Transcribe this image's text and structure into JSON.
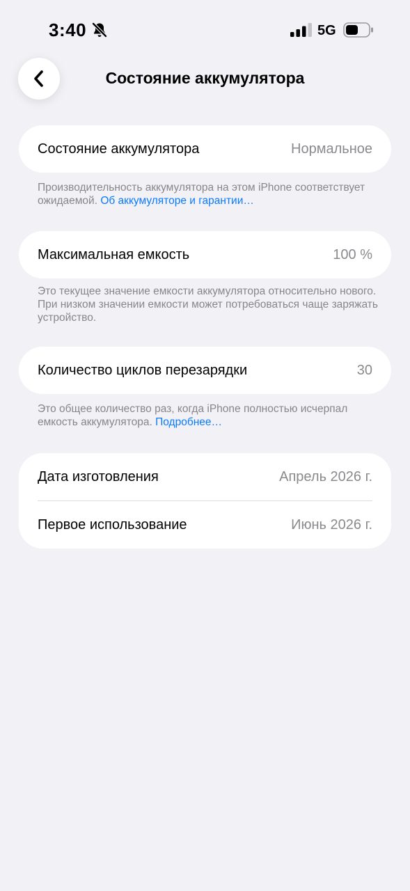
{
  "status_bar": {
    "time": "3:40",
    "network": "5G"
  },
  "nav": {
    "title": "Состояние аккумулятора"
  },
  "battery_health": {
    "label": "Состояние аккумулятора",
    "value": "Нормальное",
    "footnote_text": "Производительность аккумулятора на этом iPhone соответствует ожидаемой.",
    "footnote_link": "Об аккумуляторе и гарантии…"
  },
  "max_capacity": {
    "label": "Максимальная емкость",
    "value": "100 %",
    "footnote_text": "Это текущее значение емкости аккумулятора относительно нового. При низком значении емкости может потребоваться чаще заряжать устройство."
  },
  "cycle_count": {
    "label": "Количество циклов перезарядки",
    "value": "30",
    "footnote_text": "Это общее количество раз, когда iPhone полностью исчерпал емкость аккумулятора.",
    "footnote_link": "Подробнее…"
  },
  "dates": {
    "manufacture_label": "Дата изготовления",
    "manufacture_value": "Апрель 2026 г.",
    "first_use_label": "Первое использование",
    "first_use_value": "Июнь 2026 г."
  },
  "icons": {
    "bell": "bell-slash-icon",
    "signal": "cellular-signal-icon",
    "battery": "battery-icon",
    "back": "chevron-left-icon"
  },
  "colors": {
    "background": "#f1f1f6",
    "card": "#ffffff",
    "secondary_text": "#8a8a8e",
    "link": "#0a7aff"
  }
}
